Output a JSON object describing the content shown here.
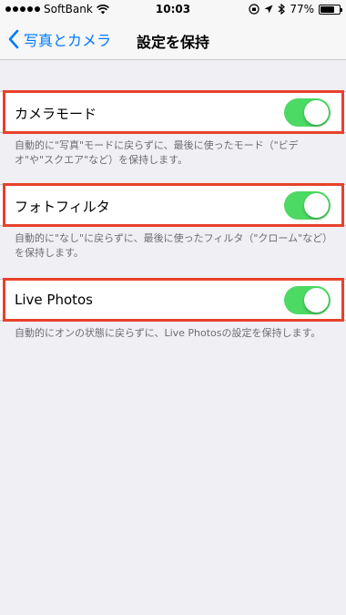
{
  "status_bar": {
    "carrier": "SoftBank",
    "time": "10:03",
    "battery": "77%",
    "battery_level": 0.77
  },
  "nav": {
    "back_label": "写真とカメラ",
    "title": "設定を保持"
  },
  "settings": [
    {
      "label": "カメラモード",
      "on": true,
      "footer": "自動的に\"写真\"モードに戻らずに、最後に使ったモード（\"ビデオ\"や\"スクエア\"など）を保持します。"
    },
    {
      "label": "フォトフィルタ",
      "on": true,
      "footer": "自動的に\"なし\"に戻らずに、最後に使ったフィルタ（\"クローム\"など）を保持します。"
    },
    {
      "label": "Live Photos",
      "on": true,
      "footer": "自動的にオンの状態に戻らずに、Live Photosの設定を保持します。"
    }
  ],
  "colors": {
    "accent": "#007aff",
    "toggle_on": "#4cd964",
    "highlight": "#e8412b"
  }
}
